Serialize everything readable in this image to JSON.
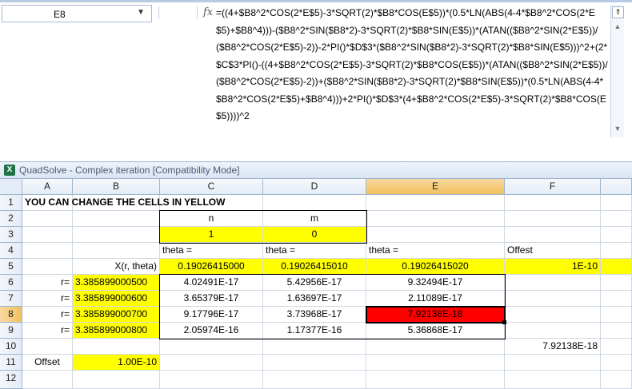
{
  "formula_bar": {
    "name_box": "E8",
    "fx_label": "fx",
    "formula": "=((4+$B8^2*COS(2*E$5)-3*SQRT(2)*$B8*COS(E$5))*(0.5*LN(ABS(4-4*$B8^2*COS(2*E$5)+$B8^4)))-($B8^2*SIN($B8*2)-3*SQRT(2)*$B8*SIN(E$5))*(ATAN(($B8^2*SIN(2*E$5))/($B8^2*COS(2*E$5)-2))-2*PI()*$D$3*($B8^2*SIN($B8*2)-3*SQRT(2)*$B8*SIN(E$5)))^2+(2*$C$3*PI()-((4+$B8^2*COS(2*E$5)-3*SQRT(2)*$B8*COS(E$5))*(ATAN(($B8^2*SIN(2*E$5))/($B8^2*COS(2*E$5)-2))+($B8^2*SIN($B8*2)-3*SQRT(2)*$B8*SIN(E$5))*(0.5*LN(ABS(4-4*$B8^2*COS(2*E$5)+$B8^4)))+2*PI()*$D$3*(4+$B8^2*COS(2*E$5)-3*SQRT(2)*$B8*COS(E$5))))^2"
  },
  "window": {
    "title": "QuadSolve - Complex iteration  [Compatibility Mode]",
    "icon_label": "X"
  },
  "columns": [
    "A",
    "B",
    "C",
    "D",
    "E",
    "F"
  ],
  "rows": [
    "1",
    "2",
    "3",
    "4",
    "5",
    "6",
    "7",
    "8",
    "9",
    "10",
    "11",
    "12"
  ],
  "cells": {
    "A1": "YOU CAN CHANGE THE CELLS IN YELLOW",
    "C2": "n",
    "D2": "m",
    "C3": "1",
    "D3": "0",
    "C4": "theta =",
    "D4": "theta =",
    "E4": "theta =",
    "F4": "Offest",
    "B5": "X(r, theta)",
    "C5": "0.19026415000",
    "D5": "0.19026415010",
    "E5": "0.19026415020",
    "F5": "1E-10",
    "A6": "r=",
    "B6": "3.385899000500",
    "C6": "4.02491E-17",
    "D6": "5.42956E-17",
    "E6": "9.32494E-17",
    "A7": "r=",
    "B7": "3.385899000600",
    "C7": "3.65379E-17",
    "D7": "1.63697E-17",
    "E7": "2.11089E-17",
    "A8": "r=",
    "B8": "3.385899000700",
    "C8": "9.17796E-17",
    "D8": "3.73968E-17",
    "E8": "7.92138E-18",
    "A9": "r=",
    "B9": "3.385899000800",
    "C9": "2.05974E-16",
    "D9": "1.17377E-16",
    "E9": "5.36868E-17",
    "F10": "7.92138E-18",
    "A11": "Offset",
    "B11": "1.00E-10"
  },
  "colors": {
    "input_fill": "#ffff00",
    "highlight_fill": "#ff0000",
    "header_selected": "#f1c15f"
  }
}
